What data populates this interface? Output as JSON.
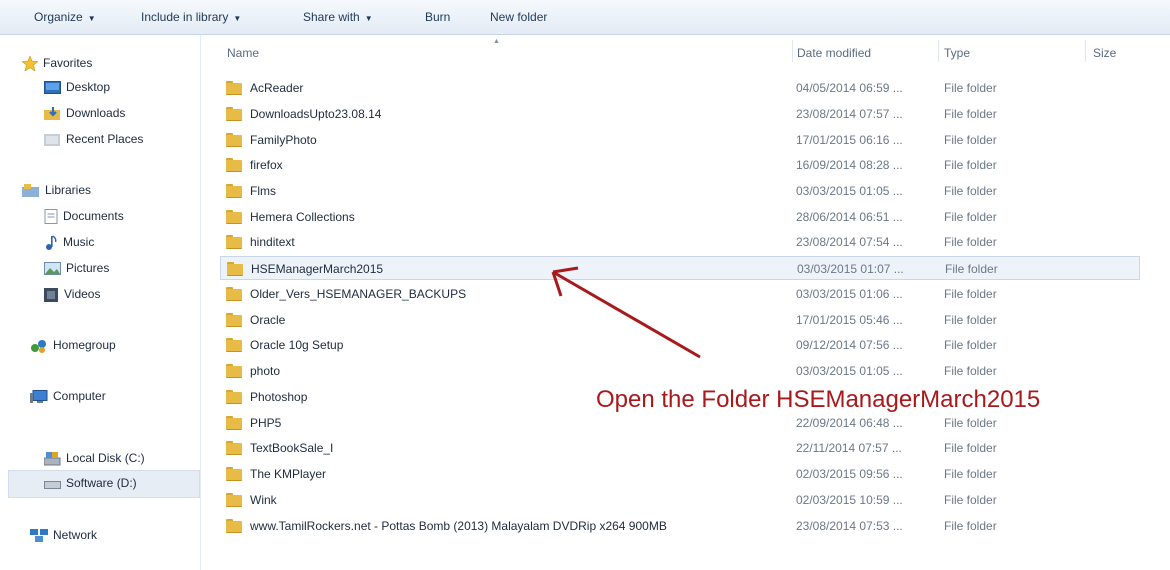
{
  "toolbar": {
    "organize": "Organize",
    "include_in_library": "Include in library",
    "share_with": "Share with",
    "burn": "Burn",
    "new_folder": "New folder"
  },
  "nav": {
    "favorites": "Favorites",
    "desktop": "Desktop",
    "downloads": "Downloads",
    "recent_places": "Recent Places",
    "libraries": "Libraries",
    "documents": "Documents",
    "music": "Music",
    "pictures": "Pictures",
    "videos": "Videos",
    "homegroup": "Homegroup",
    "computer": "Computer",
    "local_disk": "Local Disk (C:)",
    "software": "Software (D:)",
    "network": "Network"
  },
  "columns": {
    "name": "Name",
    "date_modified": "Date modified",
    "type": "Type",
    "size": "Size"
  },
  "files": [
    {
      "name": "AcReader",
      "date": "04/05/2014 06:59 ...",
      "type": "File folder"
    },
    {
      "name": "DownloadsUpto23.08.14",
      "date": "23/08/2014 07:57 ...",
      "type": "File folder"
    },
    {
      "name": "FamilyPhoto",
      "date": "17/01/2015 06:16 ...",
      "type": "File folder"
    },
    {
      "name": "firefox",
      "date": "16/09/2014 08:28 ...",
      "type": "File folder"
    },
    {
      "name": "Flms",
      "date": "03/03/2015 01:05 ...",
      "type": "File folder"
    },
    {
      "name": "Hemera Collections",
      "date": "28/06/2014 06:51 ...",
      "type": "File folder"
    },
    {
      "name": "hinditext",
      "date": "23/08/2014 07:54 ...",
      "type": "File folder"
    },
    {
      "name": "HSEManagerMarch2015",
      "date": "03/03/2015 01:07 ...",
      "type": "File folder"
    },
    {
      "name": "Older_Vers_HSEMANAGER_BACKUPS",
      "date": "03/03/2015 01:06 ...",
      "type": "File folder"
    },
    {
      "name": "Oracle",
      "date": "17/01/2015 05:46 ...",
      "type": "File folder"
    },
    {
      "name": "Oracle 10g Setup",
      "date": "09/12/2014 07:56 ...",
      "type": "File folder"
    },
    {
      "name": "photo",
      "date": "03/03/2015 01:05 ...",
      "type": "File folder"
    },
    {
      "name": "Photoshop",
      "date": "",
      "type": ""
    },
    {
      "name": "PHP5",
      "date": "22/09/2014 06:48 ...",
      "type": "File folder"
    },
    {
      "name": "TextBookSale_I",
      "date": "22/11/2014 07:57 ...",
      "type": "File folder"
    },
    {
      "name": "The KMPlayer",
      "date": "02/03/2015 09:56 ...",
      "type": "File folder"
    },
    {
      "name": "Wink",
      "date": "02/03/2015 10:59 ...",
      "type": "File folder"
    },
    {
      "name": "www.TamilRockers.net - Pottas Bomb (2013) Malayalam DVDRip x264 900MB",
      "date": "23/08/2014 07:53 ...",
      "type": "File folder"
    }
  ],
  "annotation": "Open the Folder HSEManagerMarch2015",
  "colors": {
    "annotation": "#a9191c",
    "folder": "#e8bb46"
  }
}
